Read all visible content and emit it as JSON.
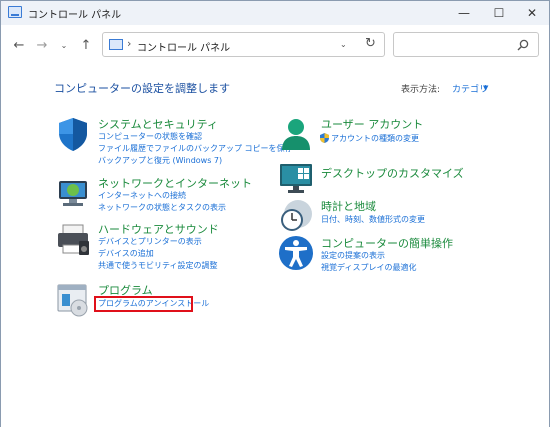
{
  "window": {
    "title": "コントロール パネル"
  },
  "controls": {
    "minimize": "—",
    "maximize": "☐",
    "close": "✕"
  },
  "nav": {
    "back": "←",
    "forward": "→",
    "dropdown": "⌄",
    "up": "↑"
  },
  "address": {
    "separator": "›",
    "path": "コントロール パネル",
    "chevron": "⌄",
    "refresh": "↻"
  },
  "search": {
    "placeholder": ""
  },
  "page": {
    "title": "コンピューターの設定を調整します",
    "view_by_label": "表示方法:",
    "view_by_value": "カテゴリ"
  },
  "categories": [
    {
      "icon": "shield-icon",
      "title": "システムとセキュリティ",
      "links": [
        "コンピューターの状態を確認",
        "ファイル履歴でファイルのバックアップ コピーを保存",
        "バックアップと復元 (Windows 7)"
      ]
    },
    {
      "icon": "network-icon",
      "title": "ネットワークとインターネット",
      "links": [
        "インターネットへの接続",
        "ネットワークの状態とタスクの表示"
      ]
    },
    {
      "icon": "printer-icon",
      "title": "ハードウェアとサウンド",
      "links": [
        "デバイスとプリンターの表示",
        "デバイスの追加",
        "共通で使うモビリティ設定の調整"
      ]
    },
    {
      "icon": "programs-icon",
      "title": "プログラム",
      "links": [
        "プログラムのアンインストール"
      ]
    },
    {
      "icon": "user-accounts-icon",
      "title": "ユーザー アカウント",
      "links": [
        "アカウントの種類の変更"
      ]
    },
    {
      "icon": "desktop-icon",
      "title": "デスクトップのカスタマイズ",
      "links": []
    },
    {
      "icon": "clock-globe-icon",
      "title": "時計と地域",
      "links": [
        "日付、時刻、数値形式の変更"
      ]
    },
    {
      "icon": "accessibility-icon",
      "title": "コンピューターの簡単操作",
      "links": [
        "設定の提案の表示",
        "視覚ディスプレイの最適化"
      ]
    }
  ],
  "colors": {
    "category_title": "#1a8a3c",
    "link": "#1a6fd6",
    "page_title": "#1a4fa0",
    "highlight": "#e0101a"
  }
}
